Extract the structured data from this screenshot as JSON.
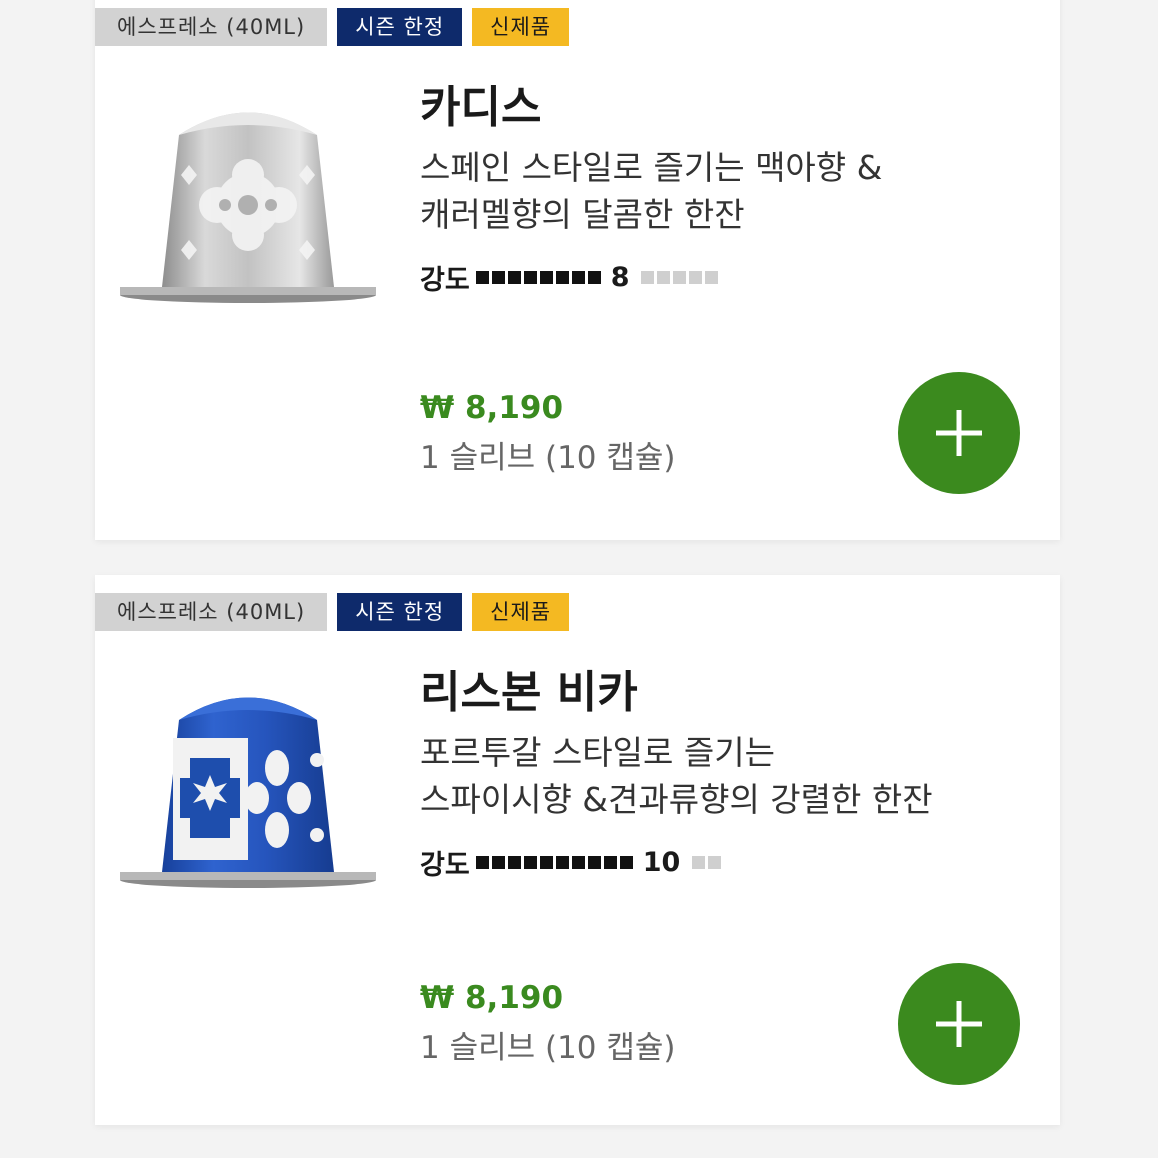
{
  "products": [
    {
      "badges": {
        "category": "에스프레소 (40ML)",
        "season": "시즌 한정",
        "new": "신제품"
      },
      "name": "카디스",
      "desc_line1": "스페인 스타일로 즐기는 맥아향 &",
      "desc_line2": "캐러멜향의 달콤한 한잔",
      "intensity_label": "강도",
      "intensity": 8,
      "intensity_max": 13,
      "price": "₩ 8,190",
      "unit": "1 슬리브 (10 캡슐)",
      "capsule_icon": "silver-capsule-icon"
    },
    {
      "badges": {
        "category": "에스프레소 (40ML)",
        "season": "시즌 한정",
        "new": "신제품"
      },
      "name": "리스본 비카",
      "desc_line1": "포르투갈 스타일로 즐기는",
      "desc_line2": "스파이시향 &견과류향의 강렬한 한잔",
      "intensity_label": "강도",
      "intensity": 10,
      "intensity_max": 12,
      "price": "₩ 8,190",
      "unit": "1 슬리브 (10 캡슐)",
      "capsule_icon": "blue-capsule-icon"
    }
  ],
  "colors": {
    "season_badge": "#0e2a6b",
    "new_badge": "#f4b922",
    "category_badge": "#d2d2d2",
    "price": "#3a8a1f",
    "add_button": "#3b8a1e"
  }
}
